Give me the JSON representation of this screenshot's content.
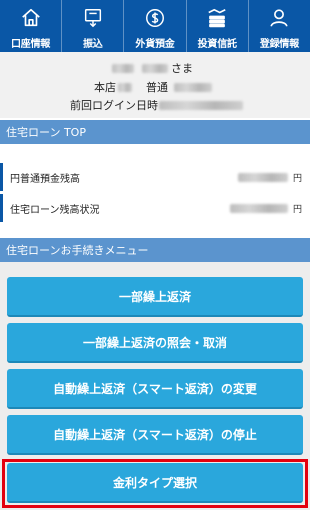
{
  "nav": {
    "items": [
      {
        "label": "口座情報",
        "icon": "home-icon"
      },
      {
        "label": "振込",
        "icon": "transfer-icon"
      },
      {
        "label": "外貨預金",
        "icon": "dollar-icon"
      },
      {
        "label": "投資信託",
        "icon": "investment-icon"
      },
      {
        "label": "登録情報",
        "icon": "user-icon"
      }
    ]
  },
  "customer": {
    "honorific": "さま",
    "branch_label": "本店",
    "account_type": "普通",
    "last_login_label": "前回ログイン日時"
  },
  "loan_section": {
    "title": "住宅ローン TOP",
    "rows": [
      {
        "label": "円普通預金残高",
        "unit": "円"
      },
      {
        "label": "住宅ローン残高状況",
        "unit": "円"
      }
    ]
  },
  "procedure_section": {
    "title": "住宅ローンお手続きメニュー",
    "buttons": [
      "一部繰上返済",
      "一部繰上返済の照会・取消",
      "自動繰上返済（スマート返済）の変更",
      "自動繰上返済（スマート返済）の停止",
      "金利タイプ選択"
    ]
  },
  "colors": {
    "nav_bg": "#0a57a6",
    "section_header": "#5b94ce",
    "button": "#2aa7dc",
    "highlight": "#e3000f"
  }
}
